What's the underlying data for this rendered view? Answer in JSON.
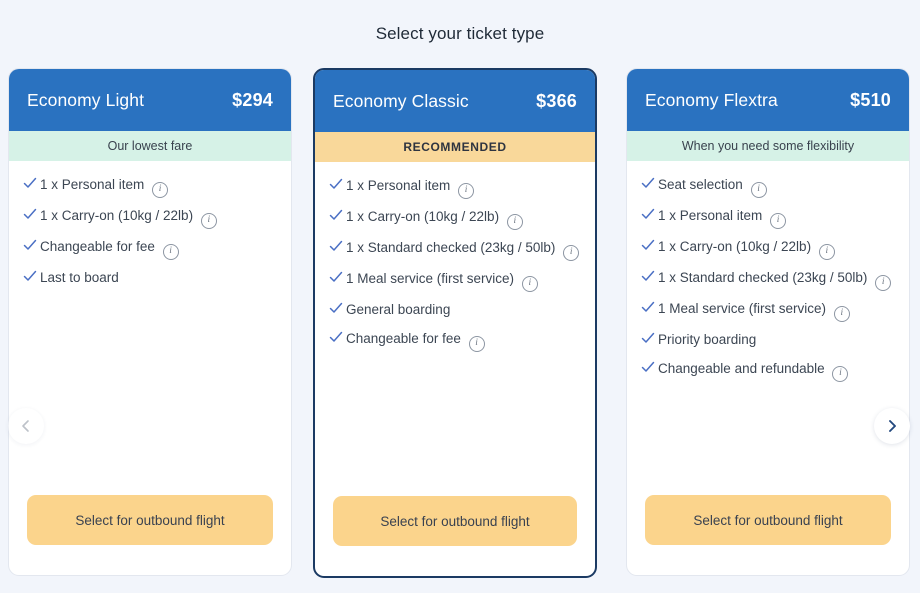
{
  "page": {
    "title": "Select your ticket type",
    "background_color": "#f2f5fb"
  },
  "colors": {
    "header_blue": "#2a72c0",
    "mint_band": "#d6f2e7",
    "amber_band": "#f9d89a",
    "button_amber": "#fbd48c",
    "check_blue": "#4a6fc4",
    "highlight_border": "#1b3a63"
  },
  "nav": {
    "prev_label": "Previous fare options",
    "next_label": "Next fare options",
    "prev_icon": "chevron-left-icon",
    "next_icon": "chevron-right-icon",
    "prev_disabled": true
  },
  "cards": [
    {
      "name": "Economy Light",
      "price": "$294",
      "band_label": "Our lowest fare",
      "band_style": "mint",
      "recommended": false,
      "button_label": "Select for outbound flight",
      "features": [
        {
          "text": "1 x Personal item",
          "info": true
        },
        {
          "text": "1 x Carry-on (10kg / 22lb)",
          "info": true
        },
        {
          "text": "Changeable for fee",
          "info": true
        },
        {
          "text": "Last to board",
          "info": false
        }
      ]
    },
    {
      "name": "Economy Classic",
      "price": "$366",
      "band_label": "RECOMMENDED",
      "band_style": "amber",
      "recommended": true,
      "button_label": "Select for outbound flight",
      "features": [
        {
          "text": "1 x Personal item",
          "info": true
        },
        {
          "text": "1 x Carry-on (10kg / 22lb)",
          "info": true
        },
        {
          "text": "1 x Standard checked (23kg / 50lb)",
          "info": true
        },
        {
          "text": "1 Meal service (first service)",
          "info": true
        },
        {
          "text": "General boarding",
          "info": false
        },
        {
          "text": "Changeable for fee",
          "info": true
        }
      ]
    },
    {
      "name": "Economy Flextra",
      "price": "$510",
      "band_label": "When you need some flexibility",
      "band_style": "mint",
      "recommended": false,
      "button_label": "Select for outbound flight",
      "features": [
        {
          "text": "Seat selection",
          "info": true
        },
        {
          "text": "1 x Personal item",
          "info": true
        },
        {
          "text": "1 x Carry-on (10kg / 22lb)",
          "info": true
        },
        {
          "text": "1 x Standard checked (23kg / 50lb)",
          "info": true
        },
        {
          "text": "1 Meal service (first service)",
          "info": true
        },
        {
          "text": "Priority boarding",
          "info": false
        },
        {
          "text": "Changeable and refundable",
          "info": true
        }
      ]
    }
  ]
}
